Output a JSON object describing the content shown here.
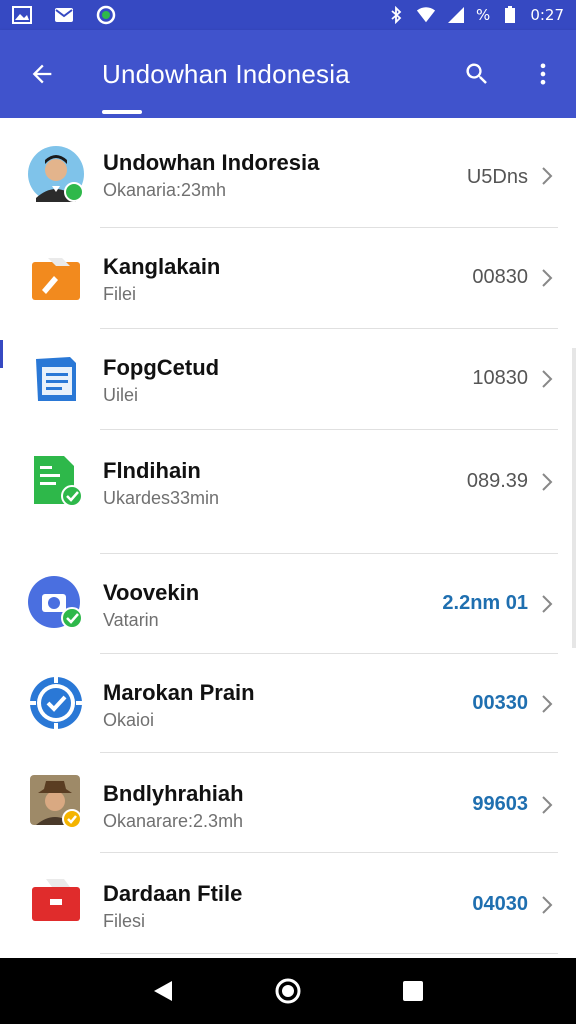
{
  "status_bar": {
    "time": "0:27",
    "battery": "%",
    "icons": [
      "gallery-icon",
      "mail-icon",
      "sync-icon",
      "bluetooth-icon",
      "wifi-icon",
      "signal-icon",
      "battery-icon"
    ]
  },
  "app_bar": {
    "title": "Undowhan Indonesia",
    "back_icon": "arrow-back-icon",
    "search_icon": "search-icon",
    "menu_icon": "more-vert-icon"
  },
  "colors": {
    "primary": "#4053cc",
    "primary_dark": "#3649c2",
    "value_blue": "#1f6fb0",
    "badge_green": "#2eb84a",
    "badge_amber": "#f4b400"
  },
  "list": {
    "items": [
      {
        "title": "Undowhan Indoresia",
        "subtitle": "Okanaria:23mh",
        "value": "U5Dns",
        "icon": "avatar-person",
        "badge": "green"
      },
      {
        "title": "Kanglakain",
        "subtitle": "Filei",
        "value": "00830",
        "icon": "orange-folder-icon",
        "badge": ""
      },
      {
        "title": "FopgCetud",
        "subtitle": "Uilei",
        "value": "10830",
        "icon": "blue-document-icon",
        "badge": ""
      },
      {
        "title": "Flndihain",
        "subtitle": "Ukardes33min",
        "value": "089.39",
        "icon": "green-spreadsheet-icon",
        "badge": "green"
      },
      {
        "title": "Voovekin",
        "subtitle": "Vatarin",
        "value": "2.2nm 01",
        "icon": "blue-camera-icon",
        "badge": "green"
      },
      {
        "title": "Marokan Prain",
        "subtitle": "Okaioi",
        "value": "00330",
        "icon": "blue-check-badge-icon",
        "badge": ""
      },
      {
        "title": "Bndlyhrahiah",
        "subtitle": "Okanarare:2.3mh",
        "value": "99603",
        "icon": "avatar-cowboy",
        "badge": "amber"
      },
      {
        "title": "Dardaan Ftile",
        "subtitle": "Filesi",
        "value": "04030",
        "icon": "red-folder-icon",
        "badge": ""
      }
    ]
  },
  "nav_bar": {
    "back": "nav-back-icon",
    "home": "nav-home-icon",
    "recents": "nav-recents-icon"
  }
}
